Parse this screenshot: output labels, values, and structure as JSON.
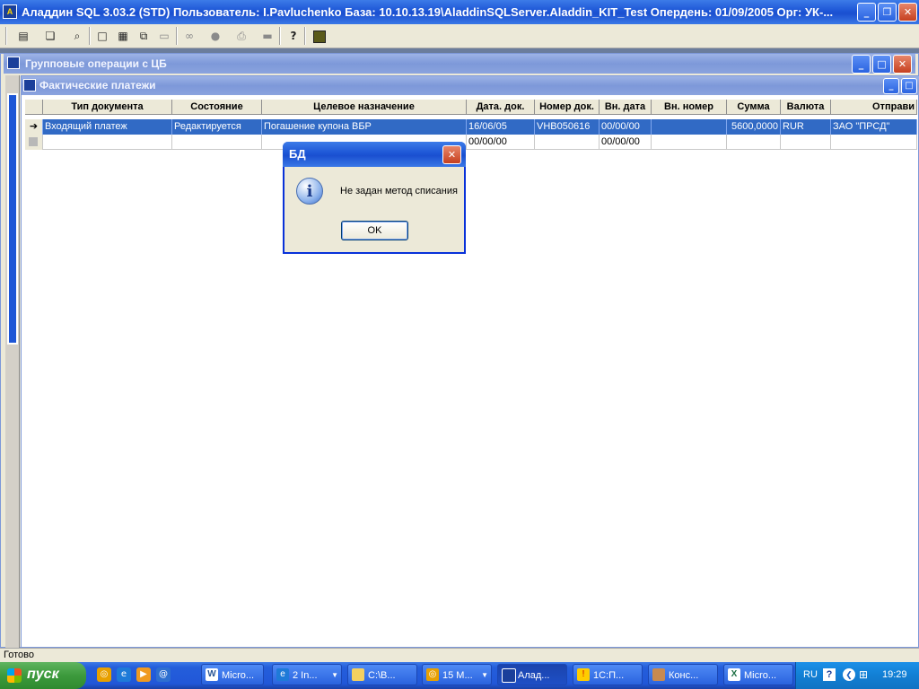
{
  "app": {
    "title": "Аладдин SQL 3.03.2 (STD)  Пользователь: I.Pavluchenko База: 10.10.13.19\\AladdinSQLServer.Aladdin_KIT_Test Опердень: 01/09/2005 Орг: УК-..."
  },
  "toolbar": {
    "buttons": [
      "document-icon",
      "copy-icon",
      "preview-icon",
      "window-icon",
      "tile-icon",
      "cascade-icon",
      "arrange-icon",
      "binoculars-icon",
      "stamp-icon",
      "print-icon",
      "export-icon",
      "help-icon",
      "exit-icon"
    ]
  },
  "group_window": {
    "title": "Групповые операции с ЦБ"
  },
  "payments_window": {
    "title": "Фактические платежи",
    "columns": [
      "Тип документа",
      "Состояние",
      "Целевое назначение",
      "Дата. док.",
      "Номер док.",
      "Вн. дата",
      "Вн. номер",
      "Сумма",
      "Валюта",
      "Отправи"
    ],
    "rows": [
      [
        "Входящий платеж",
        "Редактируется",
        "Погашение купона ВБР",
        "16/06/05",
        "VHB050616",
        "00/00/00",
        "",
        "5600,0000",
        "RUR",
        "ЗАО \"ПРСД\""
      ],
      [
        "",
        "",
        "",
        "00/00/00",
        "",
        "00/00/00",
        "",
        "",
        "",
        ""
      ]
    ]
  },
  "dialog": {
    "title": "БД",
    "message": "Не задан метод списания",
    "ok_label": "OK"
  },
  "status_bar": {
    "text": "Готово"
  },
  "taskbar": {
    "start_label": "пуск",
    "tasks": [
      "Micro...",
      "2 In...",
      "C:\\В...",
      "15 М...",
      "Алад...",
      "1С:П...",
      "Конс...",
      "Micro..."
    ],
    "lang": "RU",
    "clock": "19:29"
  }
}
